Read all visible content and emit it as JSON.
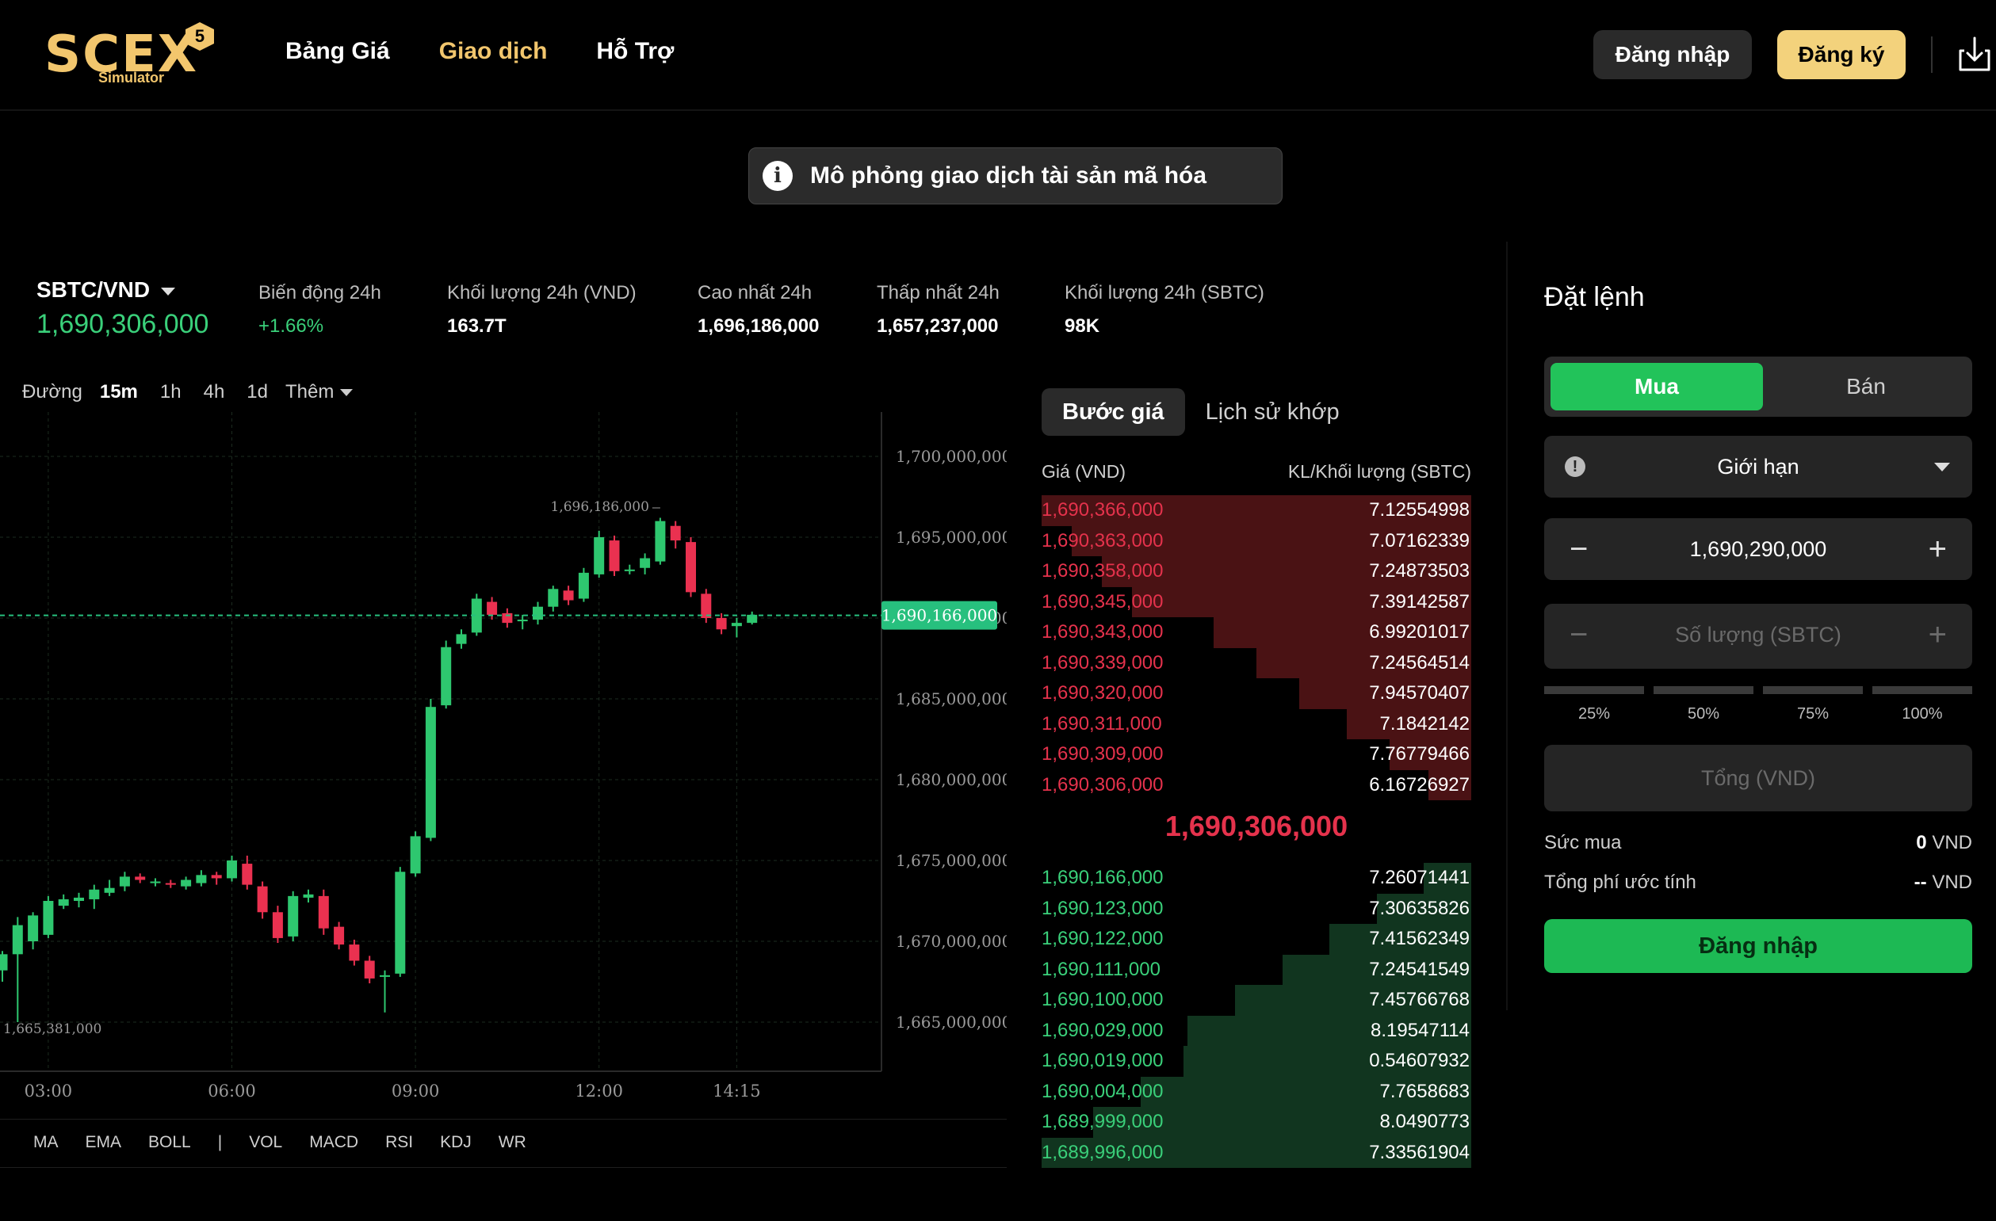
{
  "header": {
    "logo_text": "SCEX",
    "logo_sub": "Simulator",
    "logo_badge": "5",
    "nav": [
      "Bảng Giá",
      "Giao dịch",
      "Hỗ Trợ"
    ],
    "login_label": "Đăng nhập",
    "register_label": "Đăng ký"
  },
  "notice": {
    "icon": "i",
    "text": "Mô phỏng giao dịch tài sản mã hóa"
  },
  "ticker": {
    "pair": "SBTC/VND",
    "last_price": "1,690,306,000",
    "stats": [
      {
        "label": "Biến động 24h",
        "value": "+1.66%"
      },
      {
        "label": "Khối lượng 24h (VND)",
        "value": "163.7T"
      },
      {
        "label": "Cao nhất 24h",
        "value": "1,696,186,000"
      },
      {
        "label": "Thấp nhất 24h",
        "value": "1,657,237,000"
      },
      {
        "label": "Khối lượng 24h (SBTC)",
        "value": "98K"
      }
    ]
  },
  "timeframes": {
    "line": "Đường",
    "items": [
      "15m",
      "1h",
      "4h",
      "1d"
    ],
    "active": "15m",
    "more": "Thêm"
  },
  "indicators": [
    "MA",
    "EMA",
    "BOLL",
    "|",
    "VOL",
    "MACD",
    "RSI",
    "KDJ",
    "WR"
  ],
  "chart_data": {
    "type": "candlestick",
    "yticks": [
      "1,700,000,000",
      "1,695,000,000",
      "1,690,000,000",
      "1,685,000,000",
      "1,680,000,000",
      "1,675,000,000",
      "1,670,000,000",
      "1,665,000,000"
    ],
    "ytick_values": [
      1700000000,
      1695000000,
      1690000000,
      1685000000,
      1680000000,
      1675000000,
      1670000000,
      1665000000
    ],
    "xticks": [
      "03:00",
      "06:00",
      "09:00",
      "12:00",
      "14:15"
    ],
    "xtick_index": [
      3,
      15,
      27,
      39,
      48
    ],
    "current_price_label": "1,690,166,000",
    "current_price": 1690166000,
    "high_label": "1,696,186,000",
    "high_index": 43,
    "low_label": "1,665,381,000",
    "colors": {
      "up": "#2ec76f",
      "down": "#ea3150",
      "current": "#27c07e"
    },
    "candles": [
      [
        1668200000,
        1669200000,
        1667500000,
        1669400000
      ],
      [
        1669200000,
        1671000000,
        1665000000,
        1671500000
      ],
      [
        1670000000,
        1671600000,
        1669500000,
        1671800000
      ],
      [
        1670400000,
        1672500000,
        1670200000,
        1672800000
      ],
      [
        1672200000,
        1672600000,
        1672000000,
        1672900000
      ],
      [
        1672500000,
        1672700000,
        1672100000,
        1673000000
      ],
      [
        1672600000,
        1673200000,
        1672000000,
        1673500000
      ],
      [
        1673000000,
        1673300000,
        1672800000,
        1673800000
      ],
      [
        1673400000,
        1674000000,
        1673100000,
        1674300000
      ],
      [
        1674000000,
        1673800000,
        1673600000,
        1674200000
      ],
      [
        1673600000,
        1673700000,
        1673400000,
        1673900000
      ],
      [
        1673600000,
        1673500000,
        1673300000,
        1673800000
      ],
      [
        1673400000,
        1673800000,
        1673200000,
        1674000000
      ],
      [
        1673600000,
        1674100000,
        1673400000,
        1674400000
      ],
      [
        1674100000,
        1673900000,
        1673500000,
        1674300000
      ],
      [
        1673900000,
        1675000000,
        1673700000,
        1675300000
      ],
      [
        1674800000,
        1673500000,
        1673200000,
        1675300000
      ],
      [
        1673400000,
        1671800000,
        1671400000,
        1673700000
      ],
      [
        1671800000,
        1670200000,
        1669900000,
        1672200000
      ],
      [
        1670300000,
        1672800000,
        1670000000,
        1673100000
      ],
      [
        1672700000,
        1672900000,
        1672400000,
        1673200000
      ],
      [
        1672800000,
        1670800000,
        1670400000,
        1673200000
      ],
      [
        1670900000,
        1669800000,
        1669500000,
        1671200000
      ],
      [
        1669800000,
        1668800000,
        1668500000,
        1670100000
      ],
      [
        1668800000,
        1667700000,
        1667400000,
        1669100000
      ],
      [
        1667800000,
        1667900000,
        1665600000,
        1668200000
      ],
      [
        1668000000,
        1674300000,
        1667800000,
        1674600000
      ],
      [
        1674200000,
        1676500000,
        1674000000,
        1676800000
      ],
      [
        1676400000,
        1684500000,
        1676200000,
        1685000000
      ],
      [
        1684600000,
        1688200000,
        1684400000,
        1688600000
      ],
      [
        1688400000,
        1689000000,
        1688100000,
        1689300000
      ],
      [
        1689100000,
        1691200000,
        1688900000,
        1691500000
      ],
      [
        1691000000,
        1690200000,
        1689900000,
        1691300000
      ],
      [
        1690300000,
        1689700000,
        1689400000,
        1690600000
      ],
      [
        1689800000,
        1689900000,
        1689300000,
        1690200000
      ],
      [
        1689900000,
        1690700000,
        1689600000,
        1691000000
      ],
      [
        1690700000,
        1691800000,
        1690400000,
        1692000000
      ],
      [
        1691700000,
        1691100000,
        1690800000,
        1692000000
      ],
      [
        1691200000,
        1692800000,
        1691000000,
        1693100000
      ],
      [
        1692700000,
        1695000000,
        1692500000,
        1695400000
      ],
      [
        1694800000,
        1692900000,
        1692600000,
        1695100000
      ],
      [
        1692900000,
        1693000000,
        1692700000,
        1693300000
      ],
      [
        1693100000,
        1693700000,
        1692700000,
        1694000000
      ],
      [
        1693500000,
        1696000000,
        1693300000,
        1696200000
      ],
      [
        1695700000,
        1694800000,
        1694300000,
        1696000000
      ],
      [
        1694700000,
        1691600000,
        1691300000,
        1695000000
      ],
      [
        1691500000,
        1690000000,
        1689700000,
        1691800000
      ],
      [
        1690000000,
        1689300000,
        1689000000,
        1690300000
      ],
      [
        1689500000,
        1689700000,
        1688800000,
        1690000000
      ],
      [
        1689700000,
        1690200000,
        1689600000,
        1690400000
      ]
    ]
  },
  "orderbook": {
    "tabs": [
      "Bước giá",
      "Lịch sử khớp"
    ],
    "active_tab": "Bước giá",
    "col_price": "Giá (VND)",
    "col_qty": "KL/Khối lượng (SBTC)",
    "asks": [
      {
        "price": "1,690,366,000",
        "qty": "7.12554998",
        "depth": 1.0
      },
      {
        "price": "1,690,363,000",
        "qty": "7.07162339",
        "depth": 0.93
      },
      {
        "price": "1,690,358,000",
        "qty": "7.24873503",
        "depth": 0.86
      },
      {
        "price": "1,690,345,000",
        "qty": "7.39142587",
        "depth": 0.79
      },
      {
        "price": "1,690,343,000",
        "qty": "6.99201017",
        "depth": 0.6
      },
      {
        "price": "1,690,339,000",
        "qty": "7.24564514",
        "depth": 0.5
      },
      {
        "price": "1,690,320,000",
        "qty": "7.94570407",
        "depth": 0.4
      },
      {
        "price": "1,690,311,000",
        "qty": "7.1842142",
        "depth": 0.29
      },
      {
        "price": "1,690,309,000",
        "qty": "7.76779466",
        "depth": 0.19
      },
      {
        "price": "1,690,306,000",
        "qty": "6.16726927",
        "depth": 0.1
      }
    ],
    "mid_price": "1,690,306,000",
    "bids": [
      {
        "price": "1,690,166,000",
        "qty": "7.26071441",
        "depth": 0.11
      },
      {
        "price": "1,690,123,000",
        "qty": "7.30635826",
        "depth": 0.22
      },
      {
        "price": "1,690,122,000",
        "qty": "7.41562349",
        "depth": 0.33
      },
      {
        "price": "1,690,111,000",
        "qty": "7.24541549",
        "depth": 0.44
      },
      {
        "price": "1,690,100,000",
        "qty": "7.45766768",
        "depth": 0.55
      },
      {
        "price": "1,690,029,000",
        "qty": "8.19547114",
        "depth": 0.66
      },
      {
        "price": "1,690,019,000",
        "qty": "0.54607932",
        "depth": 0.67
      },
      {
        "price": "1,690,004,000",
        "qty": "7.7658683",
        "depth": 0.77
      },
      {
        "price": "1,689,999,000",
        "qty": "8.0490773",
        "depth": 0.88
      },
      {
        "price": "1,689,996,000",
        "qty": "7.33561904",
        "depth": 1.0
      }
    ]
  },
  "order_panel": {
    "title": "Đặt lệnh",
    "buy": "Mua",
    "sell": "Bán",
    "order_type": "Giới hạn",
    "price": "1,690,290,000",
    "qty_placeholder": "Số lượng (SBTC)",
    "percents": [
      "25%",
      "50%",
      "75%",
      "100%"
    ],
    "total_placeholder": "Tổng (VND)",
    "buying_power_label": "Sức mua",
    "buying_power_value": "0",
    "buying_power_unit": "VND",
    "fee_label": "Tổng phí ước tính",
    "fee_value": "--",
    "fee_unit": "VND",
    "login_button": "Đăng nhập"
  }
}
